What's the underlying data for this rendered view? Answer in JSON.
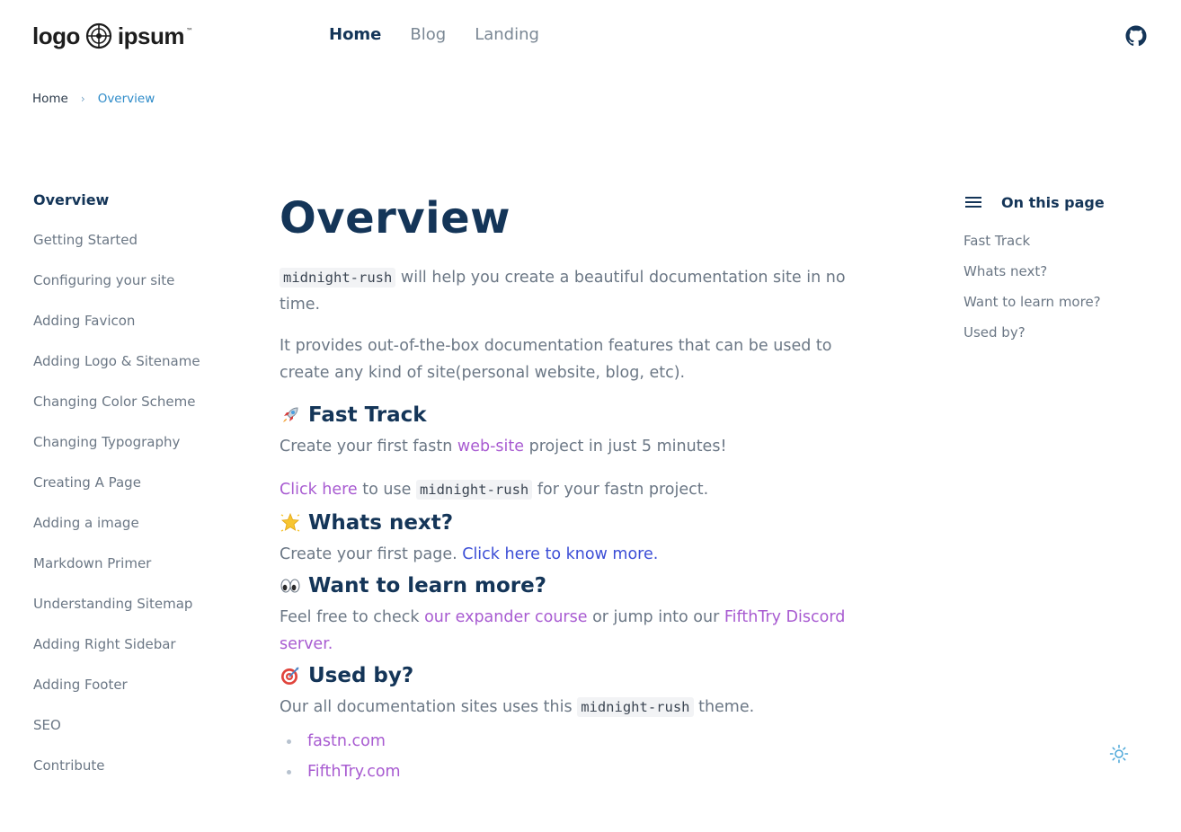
{
  "header": {
    "logo": {
      "word1": "logo",
      "word2": "ipsum",
      "tm": "™"
    },
    "nav": [
      {
        "label": "Home",
        "active": true
      },
      {
        "label": "Blog",
        "active": false
      },
      {
        "label": "Landing",
        "active": false
      }
    ],
    "github_icon": "github-icon"
  },
  "breadcrumb": {
    "home": "Home",
    "separator": "›",
    "current": "Overview"
  },
  "sidebar": {
    "items": [
      {
        "label": "Overview",
        "active": true
      },
      {
        "label": "Getting Started"
      },
      {
        "label": "Configuring your site"
      },
      {
        "label": "Adding Favicon"
      },
      {
        "label": "Adding Logo & Sitename"
      },
      {
        "label": "Changing Color Scheme"
      },
      {
        "label": "Changing Typography"
      },
      {
        "label": "Creating A Page"
      },
      {
        "label": "Adding a image"
      },
      {
        "label": "Markdown Primer"
      },
      {
        "label": "Understanding Sitemap"
      },
      {
        "label": "Adding Right Sidebar"
      },
      {
        "label": "Adding Footer"
      },
      {
        "label": "SEO"
      },
      {
        "label": "Contribute"
      }
    ]
  },
  "main": {
    "title": "Overview",
    "intro": {
      "code": "midnight-rush",
      "text": " will help you create a beautiful documentation site in no time."
    },
    "intro2": "It provides out-of-the-box documentation features that can be used to create any kind of site(personal website, blog, etc).",
    "fast_track": {
      "emoji": "rocket-icon",
      "heading": "Fast Track",
      "line1_pre": "Create your first fastn ",
      "line1_link": "web-site",
      "line1_post": " project in just 5 minutes!",
      "line2_link": "Click here",
      "line2_mid": " to use ",
      "line2_code": "midnight-rush",
      "line2_post": " for your fastn project."
    },
    "whats_next": {
      "emoji": "sparkle-star-icon",
      "heading": "Whats next?",
      "text": "Create your first page. ",
      "link": "Click here to know more."
    },
    "learn_more": {
      "emoji": "eyes-icon",
      "heading": "Want to learn more?",
      "pre": "Feel free to check ",
      "link1": "our expander course",
      "mid": " or jump into our ",
      "link2": "FifthTry Discord server."
    },
    "used_by": {
      "emoji": "target-icon",
      "heading": "Used by?",
      "pre": "Our all documentation sites uses this ",
      "code": "midnight-rush",
      "post": " theme.",
      "sites": [
        "fastn.com",
        "FifthTry.com"
      ]
    }
  },
  "toc": {
    "title": "On this page",
    "items": [
      "Fast Track",
      "Whats next?",
      "Want to learn more?",
      "Used by?"
    ]
  },
  "colors": {
    "heading": "#143558",
    "body": "#6b7785",
    "link_purple": "#a85bd1",
    "link_blue": "#3c4ed6",
    "breadcrumb_active": "#2e8bc9"
  }
}
